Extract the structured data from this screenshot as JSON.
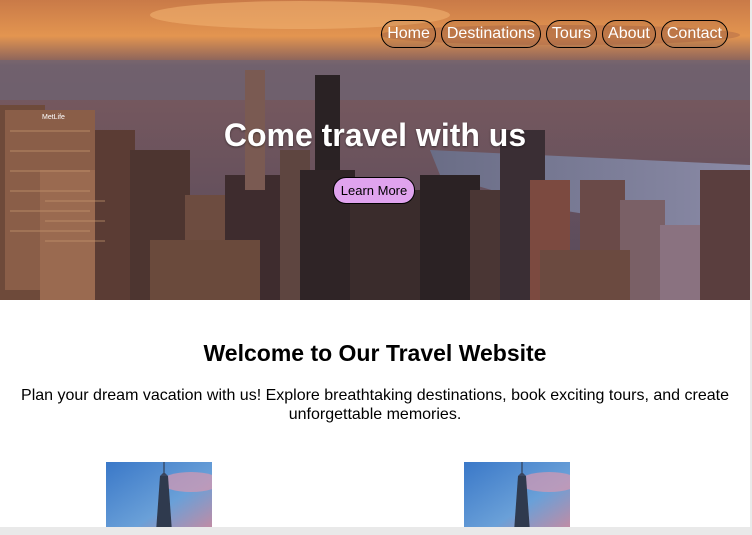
{
  "nav": {
    "items": [
      {
        "label": "Home"
      },
      {
        "label": "Destinations"
      },
      {
        "label": "Tours"
      },
      {
        "label": "About"
      },
      {
        "label": "Contact"
      }
    ]
  },
  "hero": {
    "title": "Come travel with us",
    "button_label": "Learn More",
    "building_sign": "MetLife"
  },
  "welcome": {
    "title": "Welcome to Our Travel Website",
    "text": "Plan your dream vacation with us! Explore breathtaking destinations, book exciting tours, and create unforgettable memories."
  },
  "colors": {
    "cta_background": "#e0a3ee",
    "sky_orange": "#e6934a"
  },
  "icons": {
    "hero_image": "city-skyline-image",
    "thumbnail_image": "skyscraper-image"
  }
}
